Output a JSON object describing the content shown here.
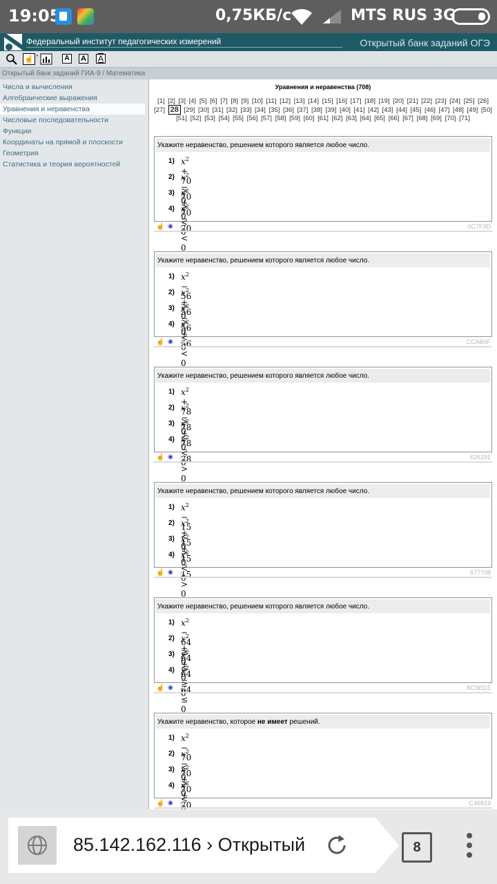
{
  "status_bar": {
    "time": "19:05",
    "speed": "0,75КБ/с",
    "carrier": "MTS RUS 3G"
  },
  "header": {
    "org": "Федеральный институт педагогических измерений",
    "bank": "Открытый банк заданий ОГЭ"
  },
  "toolbar": {
    "font_small": "A",
    "font_medium": "A",
    "font_large": "A"
  },
  "breadcrumb": "Открытый банк заданий ГИА-9 / Математика",
  "sidebar": {
    "items": [
      {
        "label": "Числа и вычисления",
        "active": false
      },
      {
        "label": "Алгебраические выражения",
        "active": false
      },
      {
        "label": "Уравнения и неравенства",
        "active": true
      },
      {
        "label": "Числовые последовательности",
        "active": false
      },
      {
        "label": "Функции",
        "active": false
      },
      {
        "label": "Координаты на прямой и плоскости",
        "active": false
      },
      {
        "label": "Геометрия",
        "active": false
      },
      {
        "label": "Статистика и теория вероятностей",
        "active": false
      }
    ]
  },
  "main": {
    "title": "Уравнения и неравенства (708)",
    "current_page": "28",
    "pages_before": [
      "[1]",
      "[2]",
      "[3]",
      "[4]",
      "[5]",
      "[6]",
      "[7]",
      "[8]",
      "[9]",
      "[10]",
      "[11]",
      "[12]",
      "[13]",
      "[14]",
      "[15]",
      "[16]",
      "[17]",
      "[18]",
      "[19]",
      "[20]",
      "[21]",
      "[22]",
      "[23]",
      "[24]",
      "[25]",
      "[26]",
      "[27]"
    ],
    "pages_after": [
      "[29]",
      "[30]",
      "[31]",
      "[32]",
      "[33]",
      "[34]",
      "[35]",
      "[36]",
      "[37]",
      "[38]",
      "[39]",
      "[40]",
      "[41]",
      "[42]",
      "[43]",
      "[44]",
      "[45]",
      "[46]",
      "[47]",
      "[48]",
      "[49]",
      "[50]",
      "[51]",
      "[52]",
      "[53]",
      "[54]",
      "[55]",
      "[56]",
      "[57]",
      "[58]",
      "[59]",
      "[60]",
      "[61]",
      "[62]",
      "[63]",
      "[64]",
      "[65]",
      "[66]",
      "[67]",
      "[68]",
      "[69]",
      "[70]",
      "[71]"
    ],
    "tasks": [
      {
        "q_before": "Укажите неравенство, решением которого является любое число.",
        "q_bold": "",
        "q_after": "",
        "options": [
          {
            "n": "1)",
            "base": "x",
            "exp": "2",
            "rest": " + 70 > 0"
          },
          {
            "n": "2)",
            "base": "x",
            "exp": "2",
            "rest": " − 70 > 0"
          },
          {
            "n": "3)",
            "base": "x",
            "exp": "2",
            "rest": " + 70 < 0"
          },
          {
            "n": "4)",
            "base": "x",
            "exp": "2",
            "rest": " − 70 < 0"
          }
        ],
        "code": "0C7F9D"
      },
      {
        "q_before": "Укажите неравенство, решением которого является любое число.",
        "q_bold": "",
        "q_after": "",
        "options": [
          {
            "n": "1)",
            "base": "x",
            "exp": "2",
            "rest": " − 56 > 0"
          },
          {
            "n": "2)",
            "base": "x",
            "exp": "2",
            "rest": " + 56 > 0"
          },
          {
            "n": "3)",
            "base": "x",
            "exp": "2",
            "rest": " − 56 < 0"
          },
          {
            "n": "4)",
            "base": "x",
            "exp": "2",
            "rest": " + 56 < 0"
          }
        ],
        "code": "CCAB6F"
      },
      {
        "q_before": "Укажите неравенство, решением которого является любое число.",
        "q_bold": "",
        "q_after": "",
        "options": [
          {
            "n": "1)",
            "base": "x",
            "exp": "2",
            "rest": " + 78 > 0"
          },
          {
            "n": "2)",
            "base": "x",
            "exp": "2",
            "rest": " − 78 < 0"
          },
          {
            "n": "3)",
            "base": "x",
            "exp": "2",
            "rest": " + 78 < 0"
          },
          {
            "n": "4)",
            "base": "x",
            "exp": "2",
            "rest": " − 78 > 0"
          }
        ],
        "code": "626291"
      },
      {
        "q_before": "Укажите неравенство, решением которого является любое число.",
        "q_bold": "",
        "q_after": "",
        "options": [
          {
            "n": "1)",
            "base": "x",
            "exp": "2",
            "rest": " − 15 < 0"
          },
          {
            "n": "2)",
            "base": "x",
            "exp": "2",
            "rest": " + 15 > 0"
          },
          {
            "n": "3)",
            "base": "x",
            "exp": "2",
            "rest": " + 15 < 0"
          },
          {
            "n": "4)",
            "base": "x",
            "exp": "2",
            "rest": " − 15 > 0"
          }
        ],
        "code": "677708"
      },
      {
        "q_before": "Укажите неравенство, решением которого является любое число.",
        "q_bold": "",
        "q_after": "",
        "options": [
          {
            "n": "1)",
            "base": "x",
            "exp": "2",
            "rest": " − 64 ≥ 0"
          },
          {
            "n": "2)",
            "base": "x",
            "exp": "2",
            "rest": " + 64 ≤ 0"
          },
          {
            "n": "3)",
            "base": "x",
            "exp": "2",
            "rest": " + 64 ≥ 0"
          },
          {
            "n": "4)",
            "base": "x",
            "exp": "2",
            "rest": " − 64 ≤ 0"
          }
        ],
        "code": "BC9ED1"
      },
      {
        "q_before": "Укажите неравенство, которое ",
        "q_bold": "не имеет",
        "q_after": " решений.",
        "options": [
          {
            "n": "1)",
            "base": "x",
            "exp": "2",
            "rest": " − 70 < 0"
          },
          {
            "n": "2)",
            "base": "x",
            "exp": "2",
            "rest": " − 70 > 0"
          },
          {
            "n": "3)",
            "base": "x",
            "exp": "2",
            "rest": " + 70 < 0"
          },
          {
            "n": "4)",
            "base": "x",
            "exp": "2",
            "rest": " + 70 > 0"
          }
        ],
        "code": "C46819"
      }
    ]
  },
  "browser": {
    "url": "85.142.162.116 › Открытый банк заданий",
    "tab_count": "8"
  },
  "icons": {
    "hand": "hand-icon",
    "eye": "view-solution-icon",
    "check": "check-icon"
  }
}
